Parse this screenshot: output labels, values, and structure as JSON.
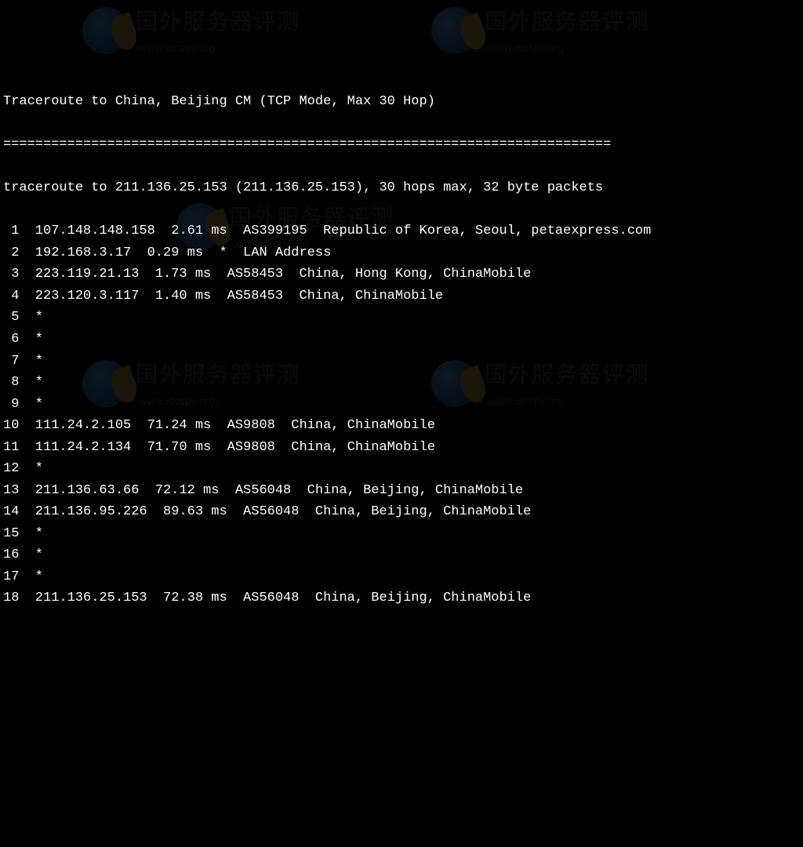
{
  "title": "Traceroute to China, Beijing CM (TCP Mode, Max 30 Hop)",
  "separator": "============================================================================",
  "summary": "traceroute to 211.136.25.153 (211.136.25.153), 30 hops max, 32 byte packets",
  "hops": [
    {
      "n": " 1",
      "ip": "107.148.148.158",
      "ms": "2.61 ms",
      "asn": "AS399195",
      "loc": "Republic of Korea, Seoul, petaexpress.com"
    },
    {
      "n": " 2",
      "ip": "192.168.3.17",
      "ms": "0.29 ms",
      "asn": "*",
      "loc": "LAN Address"
    },
    {
      "n": " 3",
      "ip": "223.119.21.13",
      "ms": "1.73 ms",
      "asn": "AS58453",
      "loc": "China, Hong Kong, ChinaMobile"
    },
    {
      "n": " 4",
      "ip": "223.120.3.117",
      "ms": "1.40 ms",
      "asn": "AS58453",
      "loc": "China, ChinaMobile"
    },
    {
      "n": " 5",
      "ip": "*",
      "ms": "",
      "asn": "",
      "loc": ""
    },
    {
      "n": " 6",
      "ip": "*",
      "ms": "",
      "asn": "",
      "loc": ""
    },
    {
      "n": " 7",
      "ip": "*",
      "ms": "",
      "asn": "",
      "loc": ""
    },
    {
      "n": " 8",
      "ip": "*",
      "ms": "",
      "asn": "",
      "loc": ""
    },
    {
      "n": " 9",
      "ip": "*",
      "ms": "",
      "asn": "",
      "loc": ""
    },
    {
      "n": "10",
      "ip": "111.24.2.105",
      "ms": "71.24 ms",
      "asn": "AS9808",
      "loc": "China, ChinaMobile"
    },
    {
      "n": "11",
      "ip": "111.24.2.134",
      "ms": "71.70 ms",
      "asn": "AS9808",
      "loc": "China, ChinaMobile"
    },
    {
      "n": "12",
      "ip": "*",
      "ms": "",
      "asn": "",
      "loc": ""
    },
    {
      "n": "13",
      "ip": "211.136.63.66",
      "ms": "72.12 ms",
      "asn": "AS56048",
      "loc": "China, Beijing, ChinaMobile"
    },
    {
      "n": "14",
      "ip": "211.136.95.226",
      "ms": "89.63 ms",
      "asn": "AS56048",
      "loc": "China, Beijing, ChinaMobile"
    },
    {
      "n": "15",
      "ip": "*",
      "ms": "",
      "asn": "",
      "loc": ""
    },
    {
      "n": "16",
      "ip": "*",
      "ms": "",
      "asn": "",
      "loc": ""
    },
    {
      "n": "17",
      "ip": "*",
      "ms": "",
      "asn": "",
      "loc": ""
    },
    {
      "n": "18",
      "ip": "211.136.25.153",
      "ms": "72.38 ms",
      "asn": "AS56048",
      "loc": "China, Beijing, ChinaMobile"
    }
  ],
  "watermark": {
    "title": "国外服务器评测",
    "url": "-www.idcspy.org-"
  }
}
